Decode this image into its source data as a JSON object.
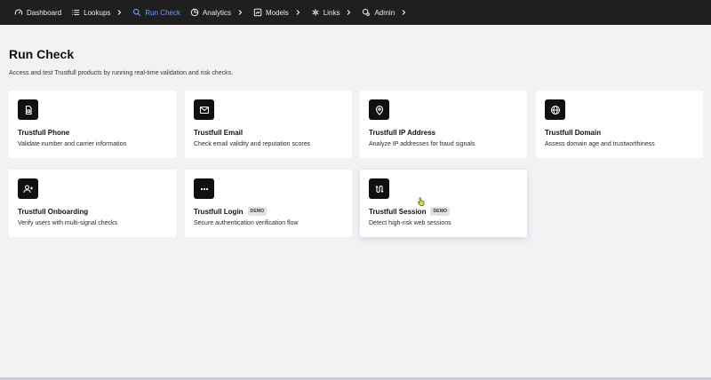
{
  "nav": {
    "items": [
      {
        "label": "Dashboard",
        "icon": "dashboard-gauge-icon",
        "chevron": false,
        "active": false
      },
      {
        "label": "Lookups",
        "icon": "list-icon",
        "chevron": true,
        "active": false
      },
      {
        "label": "Run Check",
        "icon": "search-icon",
        "chevron": false,
        "active": true
      },
      {
        "label": "Analytics",
        "icon": "analytics-pie-icon",
        "chevron": true,
        "active": false
      },
      {
        "label": "Models",
        "icon": "models-icon",
        "chevron": true,
        "active": false
      },
      {
        "label": "Links",
        "icon": "links-icon",
        "chevron": true,
        "active": false
      },
      {
        "label": "Admin",
        "icon": "admin-icon",
        "chevron": true,
        "active": false
      }
    ],
    "active_color": "#6f9bff",
    "background": "#1f1f1f"
  },
  "page": {
    "title": "Run Check",
    "subtitle": "Access and test Trustfull products by running real-time validation and risk checks."
  },
  "cards": [
    {
      "title": "Trustfull Phone",
      "desc": "Validate number and carrier information",
      "icon": "sim-card-icon",
      "badge": ""
    },
    {
      "title": "Trustfull Email",
      "desc": "Check email validity and reputation scores",
      "icon": "mail-icon",
      "badge": ""
    },
    {
      "title": "Trustfull IP Address",
      "desc": "Analyze IP addresses for fraud signals",
      "icon": "location-pin-icon",
      "badge": ""
    },
    {
      "title": "Trustfull Domain",
      "desc": "Assess domain age and trustworthiness",
      "icon": "globe-icon",
      "badge": ""
    },
    {
      "title": "Trustfull Onboarding",
      "desc": "Verify users with multi-signal checks",
      "icon": "user-add-icon",
      "badge": ""
    },
    {
      "title": "Trustfull Login",
      "desc": "Secure authentication verification flow",
      "icon": "password-dots-icon",
      "badge": "DEMO"
    },
    {
      "title": "Trustfull Session",
      "desc": "Detect high-risk web sessions",
      "icon": "session-path-icon",
      "badge": "DEMO"
    }
  ]
}
